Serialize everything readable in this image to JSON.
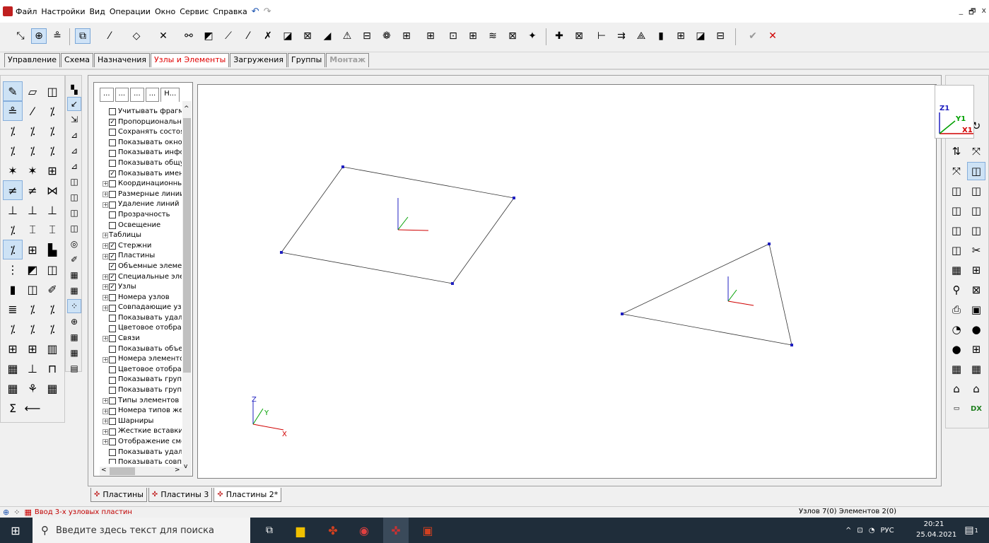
{
  "menu": {
    "items": [
      "Файл",
      "Настройки",
      "Вид",
      "Операции",
      "Окно",
      "Сервис",
      "Справка"
    ],
    "window_controls": [
      "_",
      "🗗",
      "x"
    ]
  },
  "toolbar": {
    "icons": [
      "select-icon",
      "nodes-icon",
      "numbering-icon",
      "add-plate-icon",
      "add-bar-icon",
      "add-volume-icon",
      "add-special-icon",
      "split-icon",
      "mesh-icon",
      "divide-icon",
      "triangle-icon",
      "delete-icon",
      "pack-icon",
      "rectangle-icon",
      "square-icon",
      "grid-icon",
      "rotate-icon",
      "symmetry-icon",
      "copy-icon",
      "move-icon",
      "merge-icon",
      "intersect-icon",
      "projection-icon",
      "extrude-icon",
      "surface-icon",
      "rigid-icon",
      "hinges-icon",
      "layers-icon",
      "insert-icon",
      "apply-icon",
      "cancel-icon"
    ],
    "apply_label": "✔",
    "cancel_label": "✕"
  },
  "tabs": [
    {
      "label": "Управление",
      "active": false,
      "disabled": false
    },
    {
      "label": "Схема",
      "active": false,
      "disabled": false
    },
    {
      "label": "Назначения",
      "active": false,
      "disabled": false
    },
    {
      "label": "Узлы и Элементы",
      "active": true,
      "disabled": false
    },
    {
      "label": "Загружения",
      "active": false,
      "disabled": false
    },
    {
      "label": "Группы",
      "active": false,
      "disabled": false
    },
    {
      "label": "Монтаж",
      "active": false,
      "disabled": true
    }
  ],
  "tree_tabs": [
    "...",
    "...",
    "...",
    "...",
    "Н..."
  ],
  "tree_items": [
    {
      "label": "Учитывать фрагм",
      "checked": false,
      "expandable": false
    },
    {
      "label": "Пропорционально",
      "checked": true,
      "expandable": false
    },
    {
      "label": "Сохранять состоя",
      "checked": false,
      "expandable": false
    },
    {
      "label": "Показывать окно",
      "checked": false,
      "expandable": false
    },
    {
      "label": "Показывать инфо",
      "checked": false,
      "expandable": false
    },
    {
      "label": "Показывать общу",
      "checked": false,
      "expandable": false
    },
    {
      "label": "Показывать имен",
      "checked": true,
      "expandable": false
    },
    {
      "label": "Координационные",
      "checked": false,
      "expandable": true
    },
    {
      "label": "Размерные линии",
      "checked": false,
      "expandable": true
    },
    {
      "label": "Удаление линий н",
      "checked": false,
      "expandable": true
    },
    {
      "label": "Прозрачность",
      "checked": false,
      "expandable": false
    },
    {
      "label": "Освещение",
      "checked": false,
      "expandable": false
    },
    {
      "label": "Таблицы",
      "checked": null,
      "expandable": true
    },
    {
      "label": "Стержни",
      "checked": true,
      "expandable": true
    },
    {
      "label": "Пластины",
      "checked": true,
      "expandable": true
    },
    {
      "label": "Объемные элеме",
      "checked": true,
      "expandable": false
    },
    {
      "label": "Специальные эле",
      "checked": true,
      "expandable": true
    },
    {
      "label": "Узлы",
      "checked": true,
      "expandable": true
    },
    {
      "label": "Номера узлов",
      "checked": false,
      "expandable": true
    },
    {
      "label": "Совпадающие узл",
      "checked": false,
      "expandable": true
    },
    {
      "label": "Показывать удал",
      "checked": false,
      "expandable": false
    },
    {
      "label": "Цветовое отобра:",
      "checked": false,
      "expandable": false
    },
    {
      "label": "Связи",
      "checked": false,
      "expandable": true
    },
    {
      "label": "Показывать объе",
      "checked": false,
      "expandable": false
    },
    {
      "label": "Номера элементо",
      "checked": false,
      "expandable": true
    },
    {
      "label": "Цветовое отобра:",
      "checked": false,
      "expandable": false
    },
    {
      "label": "Показывать груп",
      "checked": false,
      "expandable": false
    },
    {
      "label": "Показывать груп",
      "checked": false,
      "expandable": false
    },
    {
      "label": "Типы элементов",
      "checked": false,
      "expandable": true
    },
    {
      "label": "Номера типов же",
      "checked": false,
      "expandable": true
    },
    {
      "label": "Шарниры",
      "checked": false,
      "expandable": true
    },
    {
      "label": "Жесткие вставки",
      "checked": false,
      "expandable": true
    },
    {
      "label": "Отображение сме",
      "checked": false,
      "expandable": true
    },
    {
      "label": "Показывать удал",
      "checked": false,
      "expandable": false
    },
    {
      "label": "Показывать совп",
      "checked": false,
      "expandable": false
    }
  ],
  "axis_labels": {
    "z": "Z",
    "y": "Y",
    "x": "X",
    "z1": "Z1",
    "y1": "Y1",
    "x1": "X1"
  },
  "doc_tabs": [
    {
      "label": "Пластины",
      "active": false
    },
    {
      "label": "Пластины 3",
      "active": false
    },
    {
      "label": "Пластины 2*",
      "active": true
    }
  ],
  "status": {
    "message": "Ввод 3-х узловых пластин",
    "counts": "Узлов 7(0) Элементов 2(0)"
  },
  "taskbar": {
    "search_placeholder": "Введите здесь текст для поиска",
    "language": "РУС",
    "time": "20:21",
    "date": "25.04.2021",
    "notification_count": "1"
  },
  "right_palette": {
    "dx_label": "DX"
  }
}
